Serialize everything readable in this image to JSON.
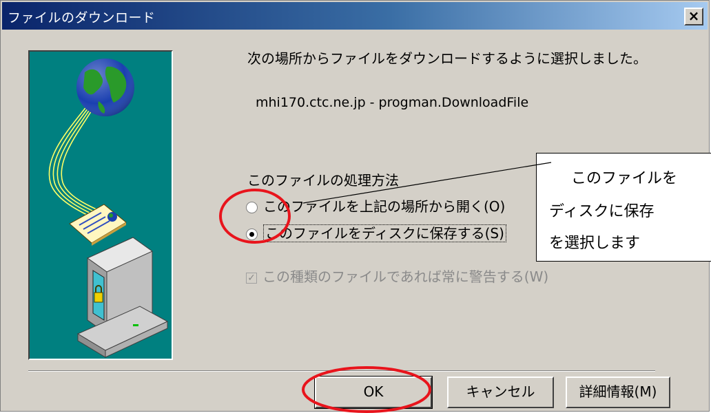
{
  "window": {
    "title": "ファイルのダウンロード",
    "close_label": "×"
  },
  "main": {
    "message": "次の場所からファイルをダウンロードするように選択しました。",
    "source": "mhi170.ctc.ne.jp - progman.DownloadFile",
    "group_label": "このファイルの処理方法",
    "radio_open_label": "このファイルを上記の場所から開く(O)",
    "radio_save_label": "このファイルをディスクに保存する(S)",
    "selected_option": "save",
    "checkbox_label": "この種類のファイルであれば常に警告する(W)",
    "checkbox_checked": true,
    "checkbox_enabled": false
  },
  "buttons": {
    "ok": "OK",
    "cancel": "キャンセル",
    "details": "詳細情報(M)"
  },
  "annotation": {
    "line1": "このファイルを",
    "line2": "ディスクに保存",
    "line3": "を選択します",
    "highlight_color": "#e8141c"
  },
  "icons": [
    "globe-icon",
    "document-icon",
    "computer-lock-icon",
    "close-icon"
  ],
  "colors": {
    "titlebar_start": "#0a246a",
    "titlebar_end": "#a6caf0",
    "panel_bg": "#008080",
    "dialog_bg": "#d4d0c8"
  }
}
